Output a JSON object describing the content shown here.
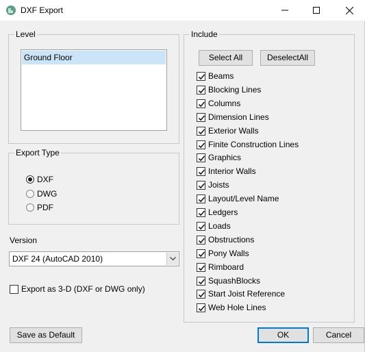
{
  "window": {
    "title": "DXF Export",
    "minimize_icon": "minimize-icon",
    "maximize_icon": "maximize-icon",
    "close_icon": "close-icon"
  },
  "level": {
    "legend": "Level",
    "items": [
      "Ground Floor"
    ],
    "selected_index": 0
  },
  "export_type": {
    "legend": "Export Type",
    "options": [
      "DXF",
      "DWG",
      "PDF"
    ],
    "selected": "DXF"
  },
  "version": {
    "label": "Version",
    "value": "DXF 24 (AutoCAD 2010)"
  },
  "export_3d": {
    "label": "Export as 3-D (DXF or DWG only)",
    "checked": false
  },
  "include": {
    "legend": "Include",
    "select_all_label": "Select All",
    "deselect_all_label": "DeselectAll",
    "items": [
      {
        "label": "Beams",
        "checked": true
      },
      {
        "label": "Blocking Lines",
        "checked": true
      },
      {
        "label": "Columns",
        "checked": true
      },
      {
        "label": "Dimension Lines",
        "checked": true
      },
      {
        "label": "Exterior Walls",
        "checked": true
      },
      {
        "label": "Finite Construction Lines",
        "checked": true
      },
      {
        "label": "Graphics",
        "checked": true
      },
      {
        "label": "Interior Walls",
        "checked": true
      },
      {
        "label": "Joists",
        "checked": true
      },
      {
        "label": "Layout/Level Name",
        "checked": true
      },
      {
        "label": "Ledgers",
        "checked": true
      },
      {
        "label": "Loads",
        "checked": true
      },
      {
        "label": "Obstructions",
        "checked": true
      },
      {
        "label": "Pony Walls",
        "checked": true
      },
      {
        "label": "Rimboard",
        "checked": true
      },
      {
        "label": "SquashBlocks",
        "checked": true
      },
      {
        "label": "Start Joist Reference",
        "checked": true
      },
      {
        "label": "Web Hole Lines",
        "checked": true
      }
    ]
  },
  "footer": {
    "save_default_label": "Save as Default",
    "ok_label": "OK",
    "cancel_label": "Cancel"
  },
  "colors": {
    "selection": "#cce4f7",
    "accent": "#0078d7",
    "dialog_bg": "#f0f0f0"
  }
}
